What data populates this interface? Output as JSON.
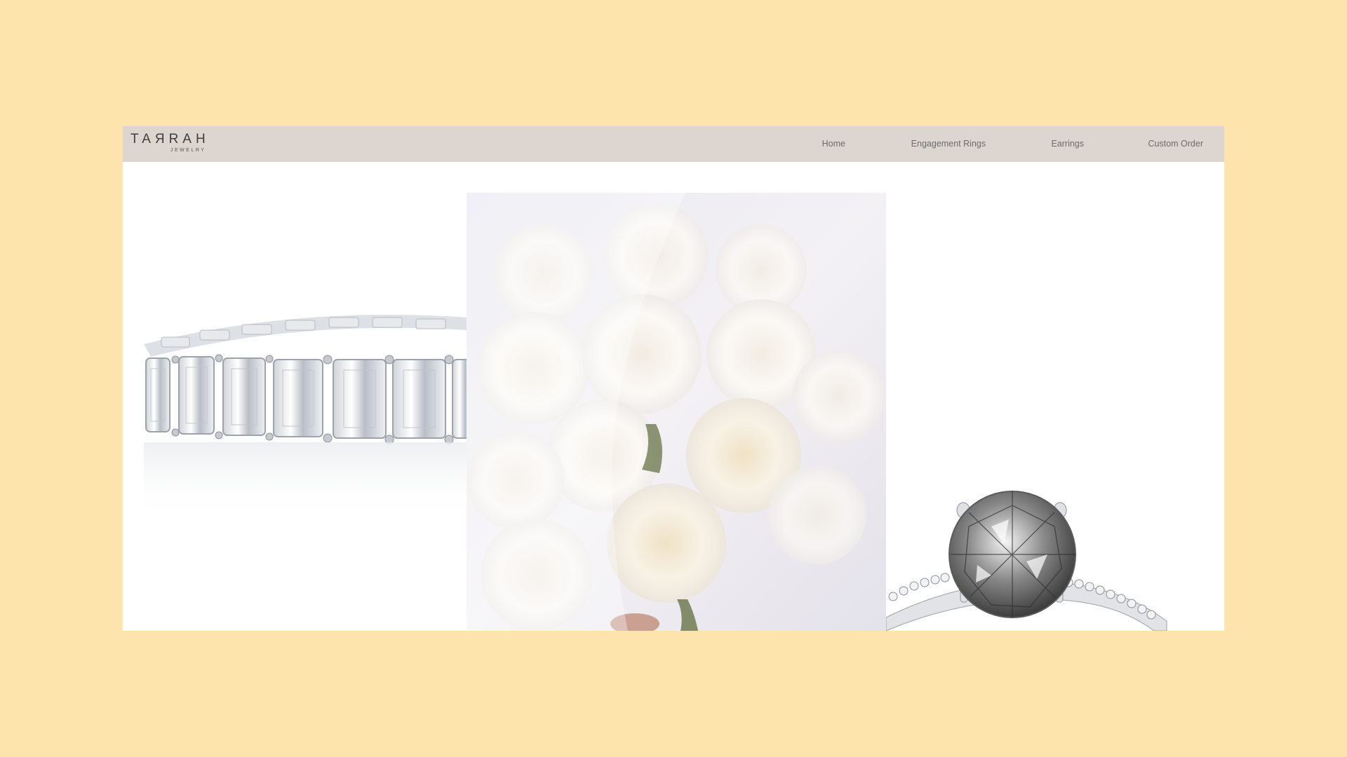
{
  "brand": {
    "logo_text": "TAЯRAH",
    "logo_subtext": "JEWELRY"
  },
  "nav": {
    "items": [
      {
        "label": "Home"
      },
      {
        "label": "Engagement Rings"
      },
      {
        "label": "Earrings"
      },
      {
        "label": "Custom Order"
      }
    ]
  },
  "colors": {
    "page_background": "#fde3ac",
    "navbar_background": "#ddd6d0",
    "content_background": "#ffffff"
  },
  "gallery": {
    "images": [
      {
        "subject": "emerald-cut-eternity-band-image"
      },
      {
        "subject": "white-rose-bouquet-image"
      },
      {
        "subject": "solitaire-engagement-ring-image"
      }
    ]
  }
}
